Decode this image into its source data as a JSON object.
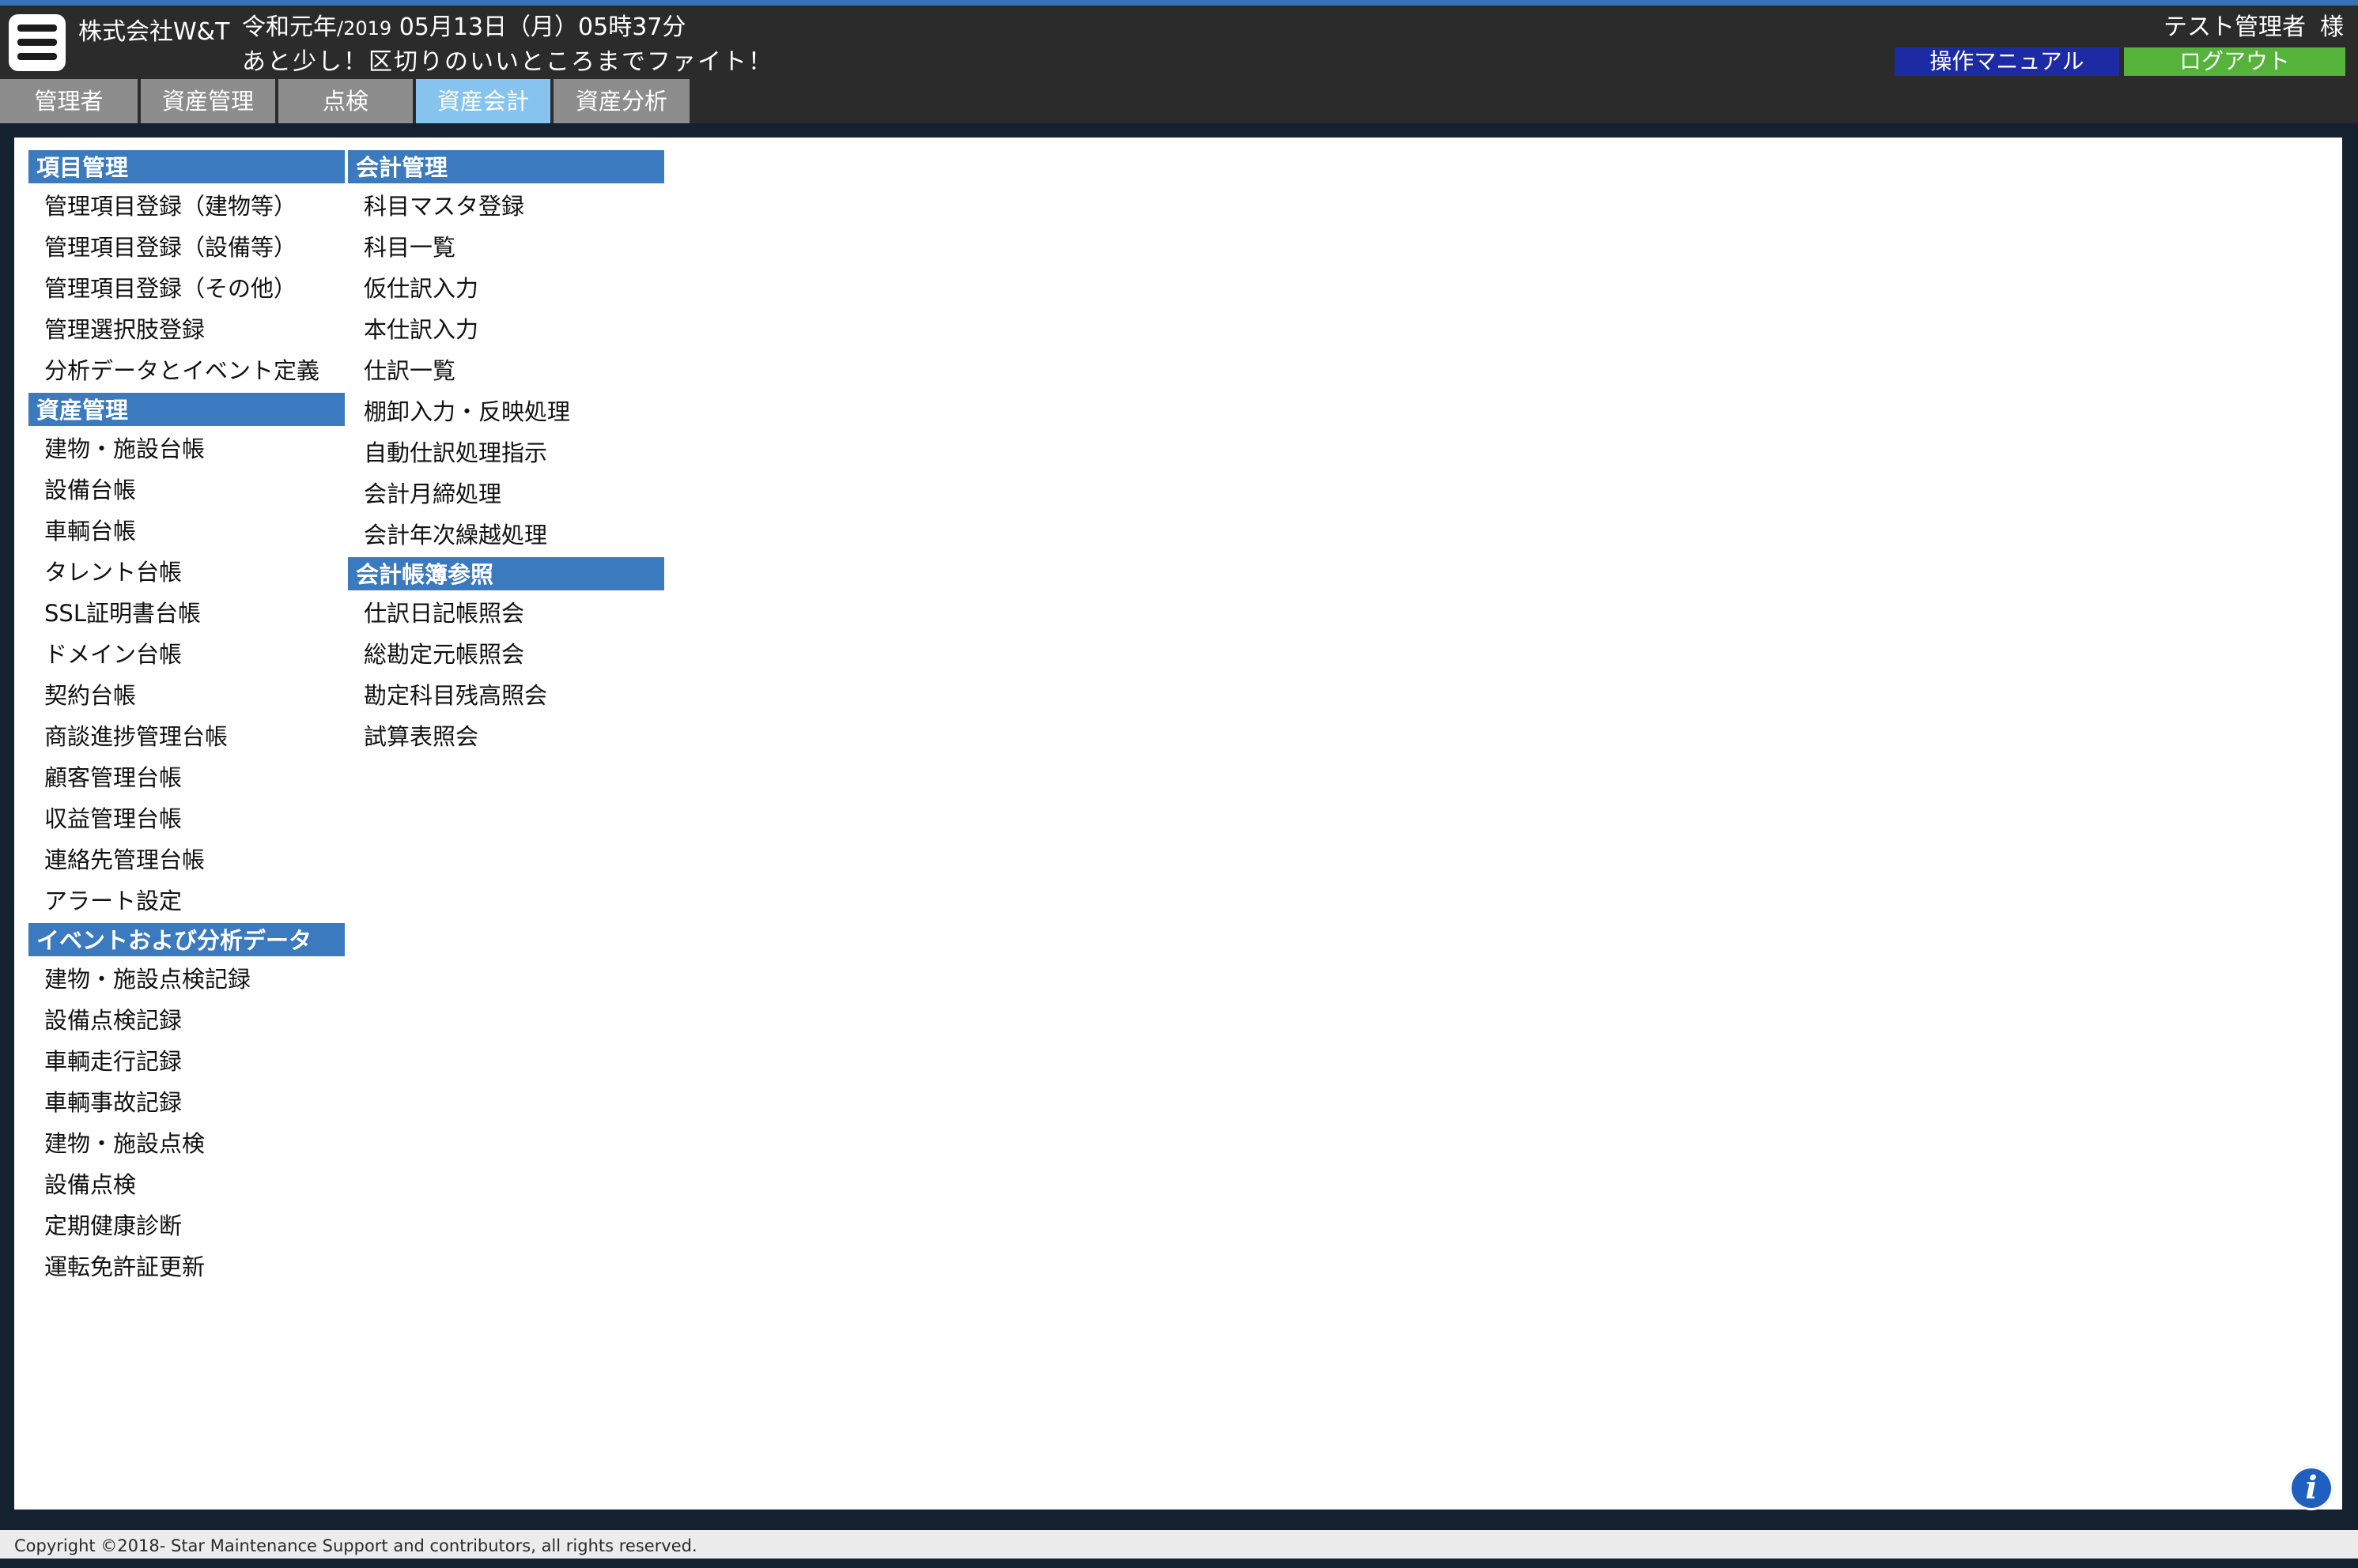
{
  "header": {
    "company": "株式会社W&T",
    "date_prefix": "令和元年",
    "date_year": "/2019",
    "date_rest": " 05月13日（月）05時37分",
    "message": "あと少し！区切りのいいところまでファイト！",
    "user_name": "テスト管理者",
    "user_suffix": "様",
    "manual_label": "操作マニュアル",
    "logout_label": "ログアウト",
    "menu_icon": "hamburger-menu-icon"
  },
  "tabs": [
    {
      "label": "管理者",
      "active": false
    },
    {
      "label": "資産管理",
      "active": false
    },
    {
      "label": "点検",
      "active": false
    },
    {
      "label": "資産会計",
      "active": true
    },
    {
      "label": "資産分析",
      "active": false
    }
  ],
  "menu": {
    "left_column": {
      "sections": [
        {
          "title": "項目管理",
          "items": [
            "管理項目登録（建物等）",
            "管理項目登録（設備等）",
            "管理項目登録（その他）",
            "管理選択肢登録",
            "分析データとイベント定義"
          ]
        },
        {
          "title": "資産管理",
          "items": [
            "建物・施設台帳",
            "設備台帳",
            "車輌台帳",
            "タレント台帳",
            "SSL証明書台帳",
            "ドメイン台帳",
            "契約台帳",
            "商談進捗管理台帳",
            "顧客管理台帳",
            "収益管理台帳",
            "連絡先管理台帳",
            "アラート設定"
          ]
        },
        {
          "title": "イベントおよび分析データ",
          "items": [
            "建物・施設点検記録",
            "設備点検記録",
            "車輌走行記録",
            "車輌事故記録",
            "建物・施設点検",
            "設備点検",
            "定期健康診断",
            "運転免許証更新"
          ]
        }
      ]
    },
    "right_column": {
      "sections": [
        {
          "title": "会計管理",
          "items": [
            "科目マスタ登録",
            "科目一覧",
            "仮仕訳入力",
            "本仕訳入力",
            "仕訳一覧",
            "棚卸入力・反映処理",
            "自動仕訳処理指示",
            "会計月締処理",
            "会計年次繰越処理"
          ]
        },
        {
          "title": "会計帳簿参照",
          "items": [
            "仕訳日記帳照会",
            "総勘定元帳照会",
            "勘定科目残高照会",
            "試算表照会"
          ]
        }
      ]
    }
  },
  "info_icon": "info-icon",
  "footer": {
    "copyright": "Copyright ©2018- Star Maintenance Support and contributors, all rights reserved."
  },
  "colors": {
    "header_bg": "#2b2b2b",
    "accent_blue": "#3b7abf",
    "active_tab": "#86c3ee",
    "tab": "#8d8d8d",
    "manual_button": "#1c2ba3",
    "logout_button": "#55b23a"
  }
}
